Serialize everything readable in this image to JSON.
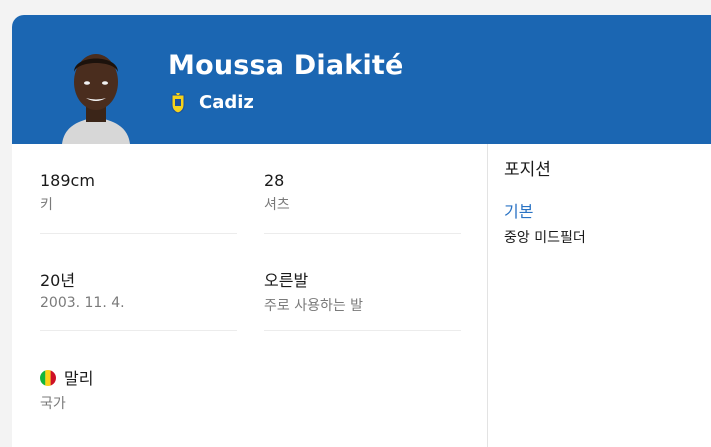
{
  "player": {
    "name": "Moussa Diakité",
    "club": "Cadiz"
  },
  "colors": {
    "header": "#1b66b2",
    "accent": "#2a73c4"
  },
  "stats": [
    {
      "value": "189cm",
      "label": "키"
    },
    {
      "value": "28",
      "label": "셔츠"
    },
    {
      "value": "20년",
      "label": "2003. 11. 4."
    },
    {
      "value": "오른발",
      "label": "주로 사용하는 발"
    },
    {
      "value": "말리",
      "label": "국가",
      "icon": "mali-flag-icon"
    }
  ],
  "position": {
    "title": "포지션",
    "primary_label": "기본",
    "role": "중앙 미드필더"
  }
}
